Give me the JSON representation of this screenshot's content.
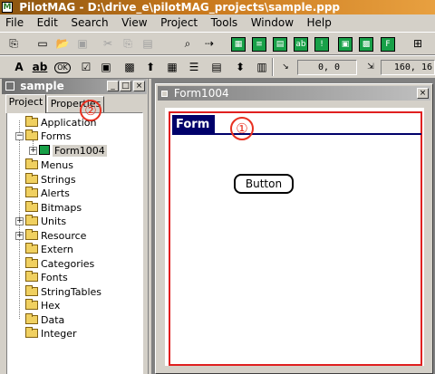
{
  "app": {
    "title": "PilotMAG - D:\\drive_e\\pilotMAG_projects\\sample.ppp",
    "icon": "app-icon"
  },
  "menu": [
    "File",
    "Edit",
    "Search",
    "View",
    "Project",
    "Tools",
    "Window",
    "Help"
  ],
  "toolbar": {
    "coord_position": "0, 0",
    "coord_size": "160, 16"
  },
  "project_panel": {
    "title": "sample",
    "tabs": [
      "Project",
      "Properties"
    ],
    "active_tab": "Project",
    "tree": [
      {
        "label": "Application",
        "expandable": false
      },
      {
        "label": "Forms",
        "expandable": true,
        "expanded": true
      },
      {
        "label": "Form1004",
        "expandable": true,
        "expanded": false,
        "child": true,
        "selected": true
      },
      {
        "label": "Menus",
        "expandable": false
      },
      {
        "label": "Strings",
        "expandable": false
      },
      {
        "label": "Alerts",
        "expandable": false
      },
      {
        "label": "Bitmaps",
        "expandable": false
      },
      {
        "label": "Units",
        "expandable": true
      },
      {
        "label": "Resource",
        "expandable": true
      },
      {
        "label": "Extern",
        "expandable": false
      },
      {
        "label": "Categories",
        "expandable": false
      },
      {
        "label": "Fonts",
        "expandable": false
      },
      {
        "label": "StringTables",
        "expandable": false
      },
      {
        "label": "Hex",
        "expandable": false
      },
      {
        "label": "Data",
        "expandable": false
      },
      {
        "label": "Integer",
        "expandable": false
      }
    ]
  },
  "form_window": {
    "title": "Form1004",
    "form_title": "Form",
    "button_label": "Button"
  },
  "callouts": {
    "one": "①",
    "two": "②"
  },
  "colors": {
    "form_title_bg": "#00006a",
    "callout": "#e83020"
  }
}
